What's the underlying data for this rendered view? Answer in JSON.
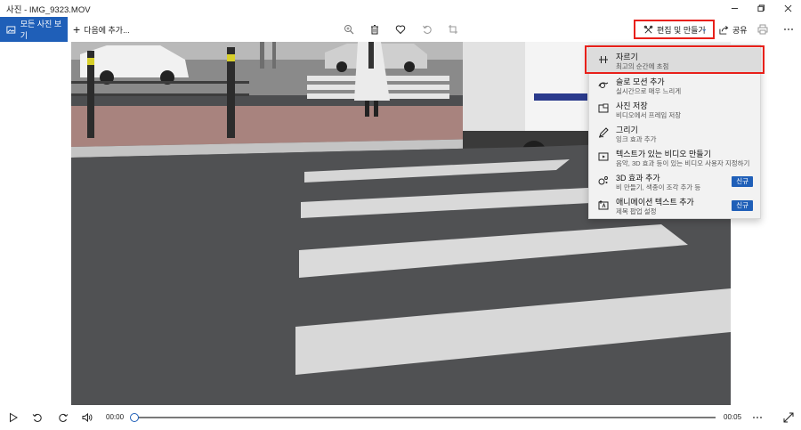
{
  "window": {
    "title": "사진 - IMG_9323.MOV",
    "controls": [
      "minimize-icon",
      "maximize-icon",
      "close-icon"
    ]
  },
  "toolbar": {
    "all_photos_label": "모든 사진 보기",
    "add_to_label": "다음에 추가...",
    "tools": [
      "zoom-icon",
      "delete-icon",
      "heart-icon",
      "rotate-icon",
      "crop-icon"
    ],
    "edit_create_label": "편집 및 만들기",
    "share_label": "공유",
    "more_icons": [
      "print-icon",
      "more-icon"
    ]
  },
  "menu": {
    "items": [
      {
        "title": "자르기",
        "subtitle": "최고의 순간에 초점",
        "icon": "trim-icon",
        "highlighted": true,
        "badge": ""
      },
      {
        "title": "슬로 모션 추가",
        "subtitle": "실시간으로 매우 느리게",
        "icon": "slow-motion-icon",
        "highlighted": false,
        "badge": ""
      },
      {
        "title": "사진 저장",
        "subtitle": "비디오에서 프레임 저장",
        "icon": "save-photo-icon",
        "highlighted": false,
        "badge": ""
      },
      {
        "title": "그리기",
        "subtitle": "잉크 효과 추가",
        "icon": "draw-icon",
        "highlighted": false,
        "badge": ""
      },
      {
        "title": "텍스트가 있는 비디오 만들기",
        "subtitle": "음악, 3D 효과 등이 있는 비디오 사용자 지정하기",
        "icon": "video-text-icon",
        "highlighted": false,
        "badge": ""
      },
      {
        "title": "3D 효과 추가",
        "subtitle": "비 만들기, 색종이 조각 추가 등",
        "icon": "3d-effects-icon",
        "highlighted": false,
        "badge": "신규"
      },
      {
        "title": "애니메이션 텍스트 추가",
        "subtitle": "제목 팝업 설정",
        "icon": "animated-text-icon",
        "highlighted": false,
        "badge": "신규"
      }
    ]
  },
  "playback": {
    "current_time": "00:00",
    "end_time": "00:05",
    "progress": 0.0,
    "controls": [
      "play-icon",
      "rewind-icon",
      "forward-icon",
      "volume-icon"
    ],
    "right_icons": [
      "more-icon",
      "fullscreen-icon"
    ]
  },
  "colors": {
    "accent": "#1f5fb8",
    "highlight_red": "#e8201a",
    "menu_bg": "#f2f2f2"
  }
}
